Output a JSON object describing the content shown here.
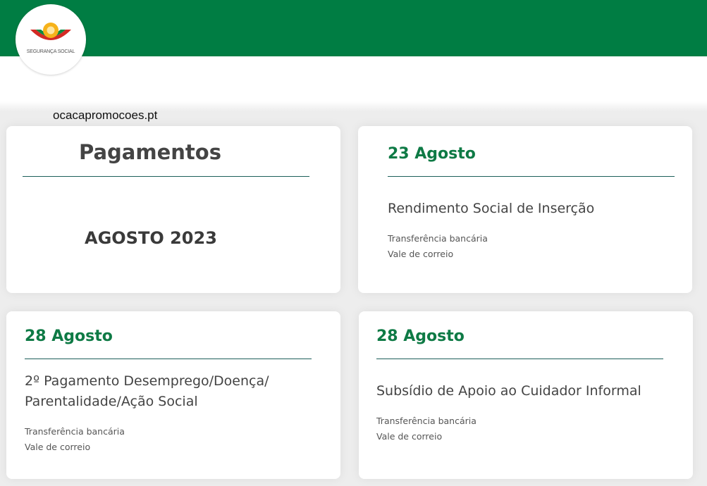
{
  "header": {
    "brand_color": "#007d43",
    "logo_text": "SEGURANÇA SOCIAL"
  },
  "watermark": "ocacapromocoes.pt",
  "intro_card": {
    "heading": "Pagamentos",
    "month": "AGOSTO 2023"
  },
  "cards": [
    {
      "date": "23 Agosto",
      "title_lines": [
        "Rendimento Social de Inserção"
      ],
      "methods": [
        "Transferência bancária",
        "Vale de correio"
      ]
    },
    {
      "date": "28 Agosto",
      "title_lines": [
        "2º Pagamento Desemprego/Doença/",
        "Parentalidade/Ação Social"
      ],
      "methods": [
        "Transferência bancária",
        "Vale de correio"
      ]
    },
    {
      "date": "28 Agosto",
      "title_lines": [
        "Subsídio de Apoio ao Cuidador Informal"
      ],
      "methods": [
        "Transferência bancária",
        "Vale de correio"
      ]
    }
  ],
  "colors": {
    "date_green": "#0e7a45",
    "rule": "#1c5f5a",
    "text_dark": "#444444"
  }
}
